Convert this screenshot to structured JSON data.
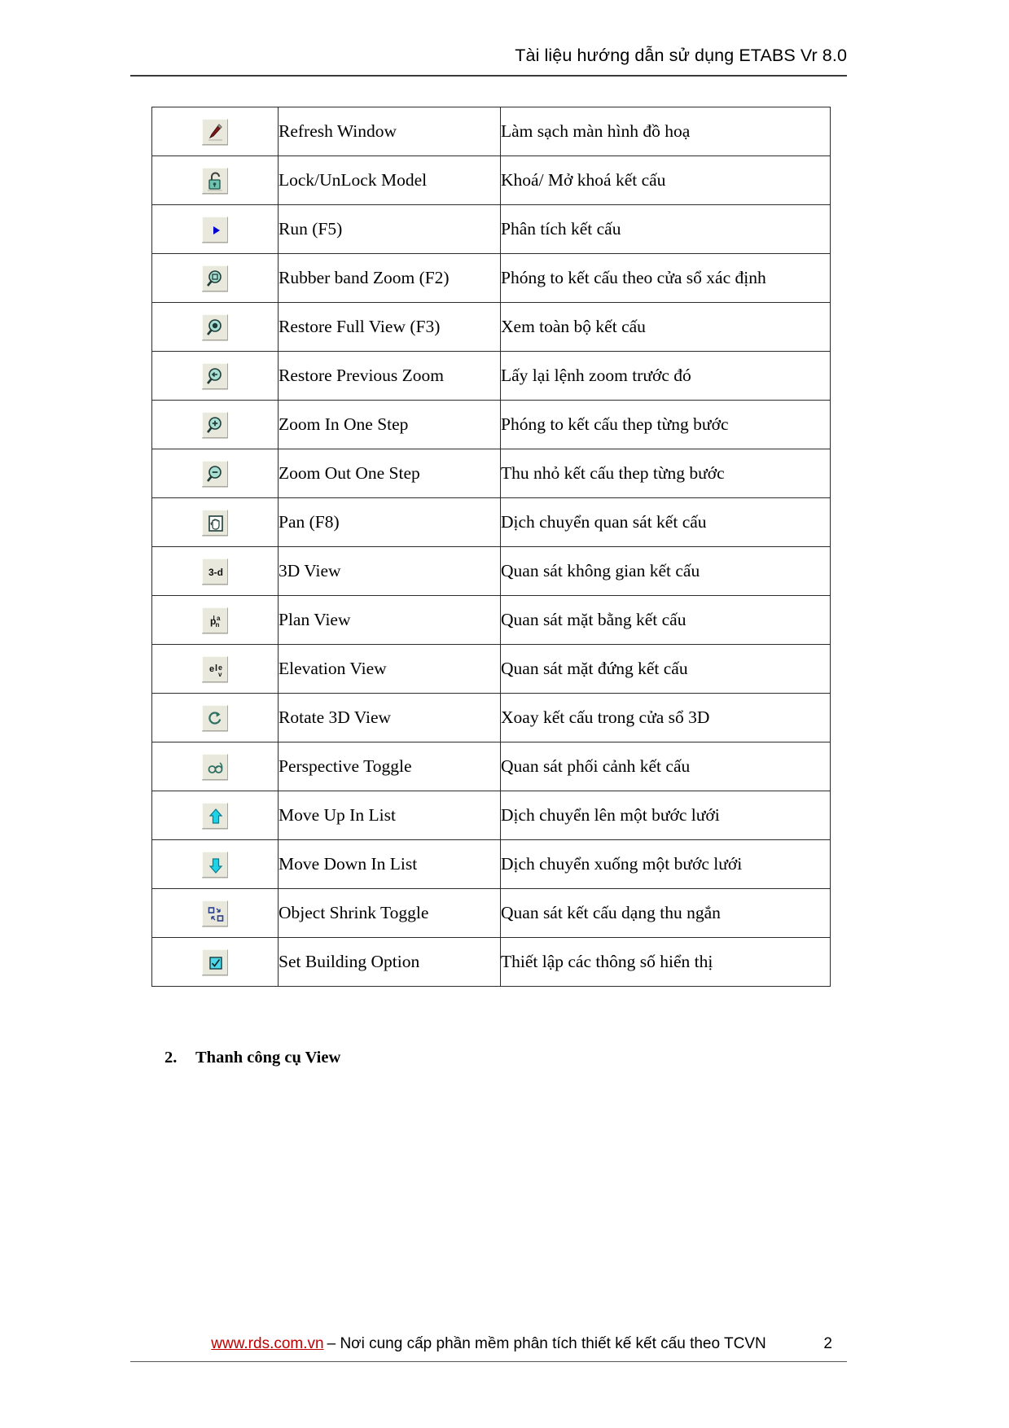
{
  "header": {
    "title": "Tài liệu hướng dẫn sử dụng ETABS Vr 8.0"
  },
  "table": {
    "rows": [
      {
        "icon": "pencil-refresh-icon",
        "name": "Refresh Window",
        "desc": "Làm sạch màn hình đồ hoạ"
      },
      {
        "icon": "padlock-open-icon",
        "name": "Lock/UnLock Model",
        "desc": "Khoá/ Mở khoá kết cấu"
      },
      {
        "icon": "run-arrow-icon",
        "name": "Run (F5)",
        "desc": "Phân tích kết cấu"
      },
      {
        "icon": "rubber-band-zoom-icon",
        "name": "Rubber band Zoom (F2)",
        "desc": "Phóng to kết cấu theo cửa sổ xác định"
      },
      {
        "icon": "restore-full-view-icon",
        "name": "Restore Full View (F3)",
        "desc": "Xem toàn bộ kết cấu"
      },
      {
        "icon": "restore-previous-zoom-icon",
        "name": "Restore Previous Zoom",
        "desc": "Lấy lại  lệnh zoom trước đó"
      },
      {
        "icon": "zoom-in-icon",
        "name": "Zoom In One Step",
        "desc": "Phóng to kết cấu thep từng bước"
      },
      {
        "icon": "zoom-out-icon",
        "name": "Zoom Out One Step",
        "desc": "Thu nhỏ kết cấu thep từng bước"
      },
      {
        "icon": "pan-hand-icon",
        "name": "Pan (F8)",
        "desc": "Dịch chuyển quan sát kết cấu"
      },
      {
        "icon": "three-d-view-icon",
        "name": "3D View",
        "desc": "Quan sát không gian kết cấu"
      },
      {
        "icon": "plan-view-icon",
        "name": "Plan View",
        "desc": "Quan sát mặt bằng  kết cấu"
      },
      {
        "icon": "elevation-view-icon",
        "name": "Elevation View",
        "desc": "Quan sát mặt đứng kết cấu"
      },
      {
        "icon": "rotate-3d-view-icon",
        "name": "Rotate 3D View",
        "desc": "Xoay kết cấu trong cửa sổ 3D"
      },
      {
        "icon": "perspective-toggle-icon",
        "name": "Perspective Toggle",
        "desc": "Quan sát phối cảnh kết cấu"
      },
      {
        "icon": "arrow-up-icon",
        "name": "Move Up In List",
        "desc": "Dịch chuyển lên một bước lưới"
      },
      {
        "icon": "arrow-down-icon",
        "name": "Move Down In List",
        "desc": "Dịch chuyển xuống một bước lưới"
      },
      {
        "icon": "object-shrink-toggle-icon",
        "name": "Object Shrink Toggle",
        "desc": "Quan sát kết cấu dạng thu ngắn"
      },
      {
        "icon": "checkbox-option-icon",
        "name": "Set Building Option",
        "desc": "Thiết lập các thông số hiển thị"
      }
    ]
  },
  "section": {
    "number": "2.",
    "title": "Thanh công cụ View"
  },
  "footer": {
    "url": "www.rds.com.vn",
    "text": "– Nơi cung cấp phần mềm phân tích thiết kế kết cấu theo TCVN",
    "page": "2"
  },
  "colors": {
    "link": "#c00000",
    "icon_teal": "#2e8b7a",
    "icon_cyan": "#00c8d7",
    "icon_blue": "#0000cd",
    "rule": "#3a3a3a"
  }
}
